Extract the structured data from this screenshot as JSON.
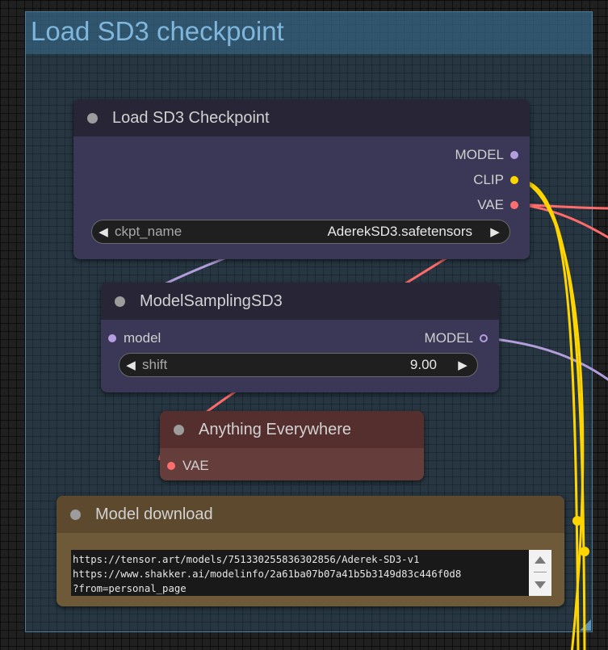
{
  "group": {
    "title": "Load SD3 checkpoint"
  },
  "load_checkpoint": {
    "title": "Load SD3 Checkpoint",
    "outputs": [
      "MODEL",
      "CLIP",
      "VAE"
    ],
    "widget": {
      "label": "ckpt_name",
      "value": "AderekSD3.safetensors"
    }
  },
  "model_sampling": {
    "title": "ModelSamplingSD3",
    "input": "model",
    "output": "MODEL",
    "widget": {
      "label": "shift",
      "value": "9.00"
    }
  },
  "anything_everywhere": {
    "title": "Anything Everywhere",
    "input": "VAE"
  },
  "model_download": {
    "title": "Model download",
    "text": "https://tensor.art/models/751330255836302856/Aderek-SD3-v1\nhttps://www.shakker.ai/modelinfo/2a61ba07b07a41b5b3149d83c446f0d8\n?from=personal_page"
  },
  "colors": {
    "model_slot": "#b49ee0",
    "clip_slot": "#ffd500",
    "vae_slot": "#ff6e6e",
    "clip_wire": "#ffd500",
    "vae_wire": "#ff6b6b",
    "model_wire": "#b39ddb"
  }
}
